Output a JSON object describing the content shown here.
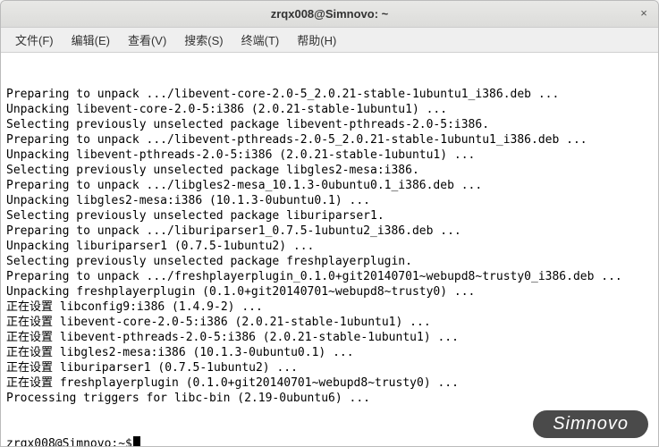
{
  "window": {
    "title": "zrqx008@Simnovo: ~",
    "close_glyph": "×"
  },
  "menu": {
    "file": "文件(F)",
    "edit": "编辑(E)",
    "view": "查看(V)",
    "search": "搜索(S)",
    "terminal": "终端(T)",
    "help": "帮助(H)"
  },
  "terminal": {
    "lines": [
      "Preparing to unpack .../libevent-core-2.0-5_2.0.21-stable-1ubuntu1_i386.deb ...",
      "Unpacking libevent-core-2.0-5:i386 (2.0.21-stable-1ubuntu1) ...",
      "Selecting previously unselected package libevent-pthreads-2.0-5:i386.",
      "Preparing to unpack .../libevent-pthreads-2.0-5_2.0.21-stable-1ubuntu1_i386.deb ...",
      "Unpacking libevent-pthreads-2.0-5:i386 (2.0.21-stable-1ubuntu1) ...",
      "Selecting previously unselected package libgles2-mesa:i386.",
      "Preparing to unpack .../libgles2-mesa_10.1.3-0ubuntu0.1_i386.deb ...",
      "Unpacking libgles2-mesa:i386 (10.1.3-0ubuntu0.1) ...",
      "Selecting previously unselected package liburiparser1.",
      "Preparing to unpack .../liburiparser1_0.7.5-1ubuntu2_i386.deb ...",
      "Unpacking liburiparser1 (0.7.5-1ubuntu2) ...",
      "Selecting previously unselected package freshplayerplugin.",
      "Preparing to unpack .../freshplayerplugin_0.1.0+git20140701~webupd8~trusty0_i386.deb ...",
      "Unpacking freshplayerplugin (0.1.0+git20140701~webupd8~trusty0) ...",
      "正在设置 libconfig9:i386 (1.4.9-2) ...",
      "正在设置 libevent-core-2.0-5:i386 (2.0.21-stable-1ubuntu1) ...",
      "正在设置 libevent-pthreads-2.0-5:i386 (2.0.21-stable-1ubuntu1) ...",
      "正在设置 libgles2-mesa:i386 (10.1.3-0ubuntu0.1) ...",
      "正在设置 liburiparser1 (0.7.5-1ubuntu2) ...",
      "正在设置 freshplayerplugin (0.1.0+git20140701~webupd8~trusty0) ...",
      "Processing triggers for libc-bin (2.19-0ubuntu6) ..."
    ],
    "prompt": "zrqx008@Simnovo:~$"
  },
  "watermark": "Simnovo"
}
